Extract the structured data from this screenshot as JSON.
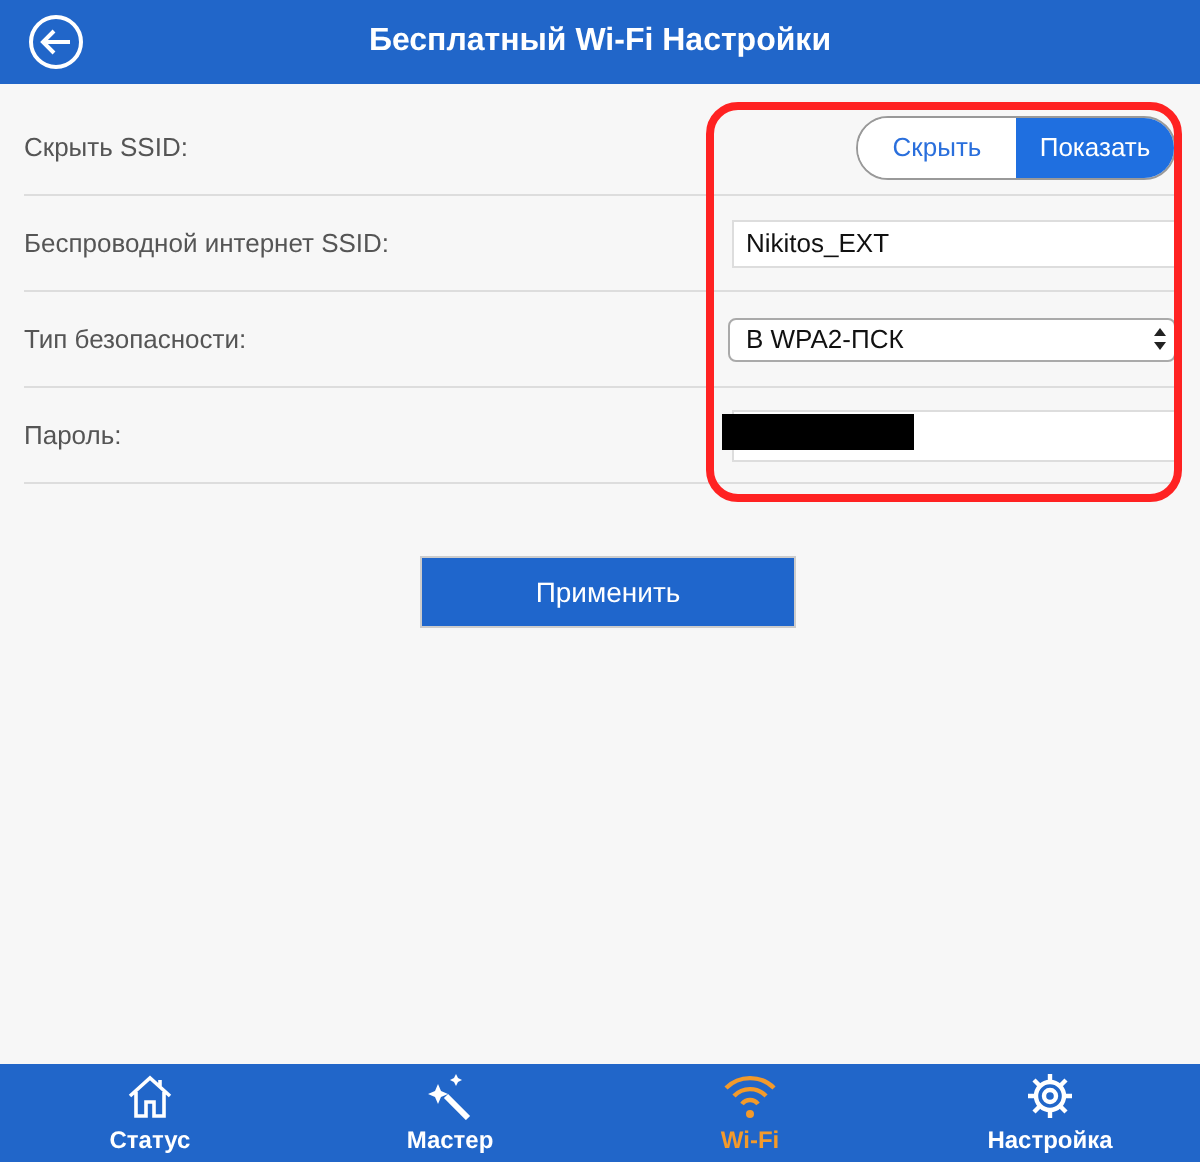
{
  "header": {
    "title": "Бесплатный Wi-Fi Настройки"
  },
  "settings": [
    {
      "kind": "toggle",
      "label": "Скрыть SSID:",
      "options": [
        {
          "label": "Скрыть",
          "selected": false
        },
        {
          "label": "Показать",
          "selected": true
        }
      ]
    },
    {
      "kind": "text",
      "label": "Беспроводной интернет SSID:",
      "value": "Nikitos_EXT"
    },
    {
      "kind": "select",
      "label": "Тип безопасности:",
      "value": "В WPA2-ПСК"
    },
    {
      "kind": "password",
      "label": "Пароль:",
      "redacted": true
    }
  ],
  "highlight": true,
  "apply_button": "Применить",
  "nav": [
    {
      "label": "Статус",
      "selected": false
    },
    {
      "label": "Мастер",
      "selected": false
    },
    {
      "label": "Wi-Fi",
      "selected": true
    },
    {
      "label": "Настройка",
      "selected": false
    }
  ]
}
